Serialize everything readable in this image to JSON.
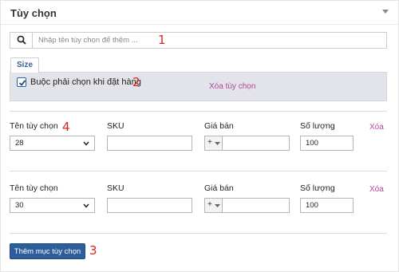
{
  "panel": {
    "title": "Tùy chọn"
  },
  "search": {
    "placeholder": "Nhập tên tùy chọn để thêm ..."
  },
  "annotations": {
    "n1": "1",
    "n2": "2",
    "n3": "3",
    "n4": "4"
  },
  "option_group": {
    "tab_label": "Size",
    "required_checked": true,
    "required_label": "Buộc phải chọn khi đặt hàng",
    "remove_label": "Xóa tùy chọn"
  },
  "columns": {
    "name": "Tên tùy chọn",
    "sku": "SKU",
    "price": "Giá bán",
    "quantity": "Số lượng",
    "delete": "Xóa"
  },
  "items": [
    {
      "name": "28",
      "sku": "",
      "price_sign": "+",
      "price": "",
      "quantity": "100"
    },
    {
      "name": "30",
      "sku": "",
      "price_sign": "+",
      "price": "",
      "quantity": "100"
    }
  ],
  "add_button_label": "Thêm mục tùy chọn",
  "colors": {
    "accent": "#2e5d9c",
    "delete_link": "#b0499a",
    "annotation": "#d9251d",
    "group_bg": "#e3e3ea"
  }
}
